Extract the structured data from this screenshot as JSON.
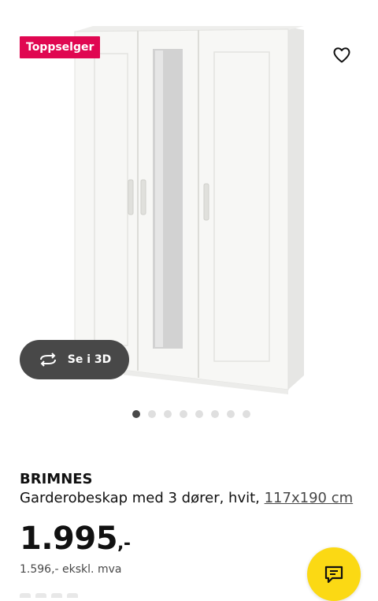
{
  "product": {
    "badge": "Toppselger",
    "view_3d_label": "Se i 3D",
    "brand": "BRIMNES",
    "description": "Garderobeskap med 3 dører, hvit,",
    "size_link": "117x190 cm",
    "price_main": "1.995",
    "price_suffix": ",-",
    "price_excl_vat": "1.596,- ekskl. mva",
    "image_count": 8,
    "active_image": 1
  },
  "icons": {
    "favourite": "heart-outline-icon",
    "view3d": "rotate-3d-icon",
    "chat": "chat-bubble-icon"
  },
  "colors": {
    "badge": "#e00751",
    "view3d_bg": "#484848",
    "chat_bg": "#fbd914",
    "dot_active": "#484848",
    "dot_inactive": "#dfdfdf"
  }
}
